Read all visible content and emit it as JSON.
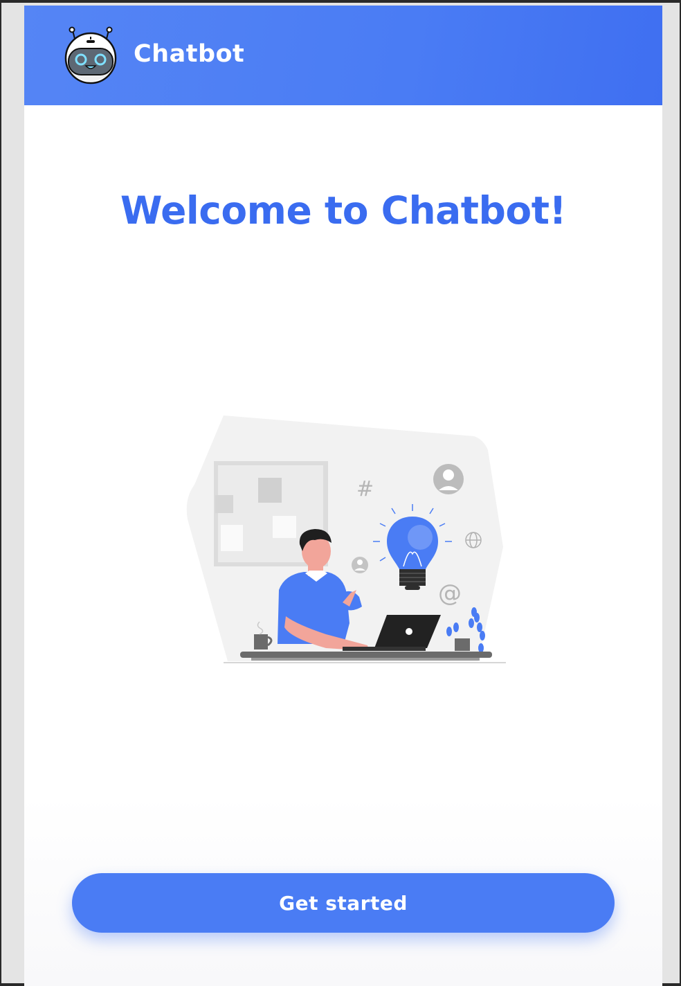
{
  "header": {
    "title": "Chatbot",
    "logo_icon": "robot-face-icon",
    "color": "#4a7cf4"
  },
  "main": {
    "heading": "Welcome to Chatbot!",
    "illustration": "person-at-laptop-with-lightbulb",
    "accent_color": "#3a6cf0"
  },
  "cta": {
    "label": "Get started",
    "color": "#4a7cf4"
  }
}
